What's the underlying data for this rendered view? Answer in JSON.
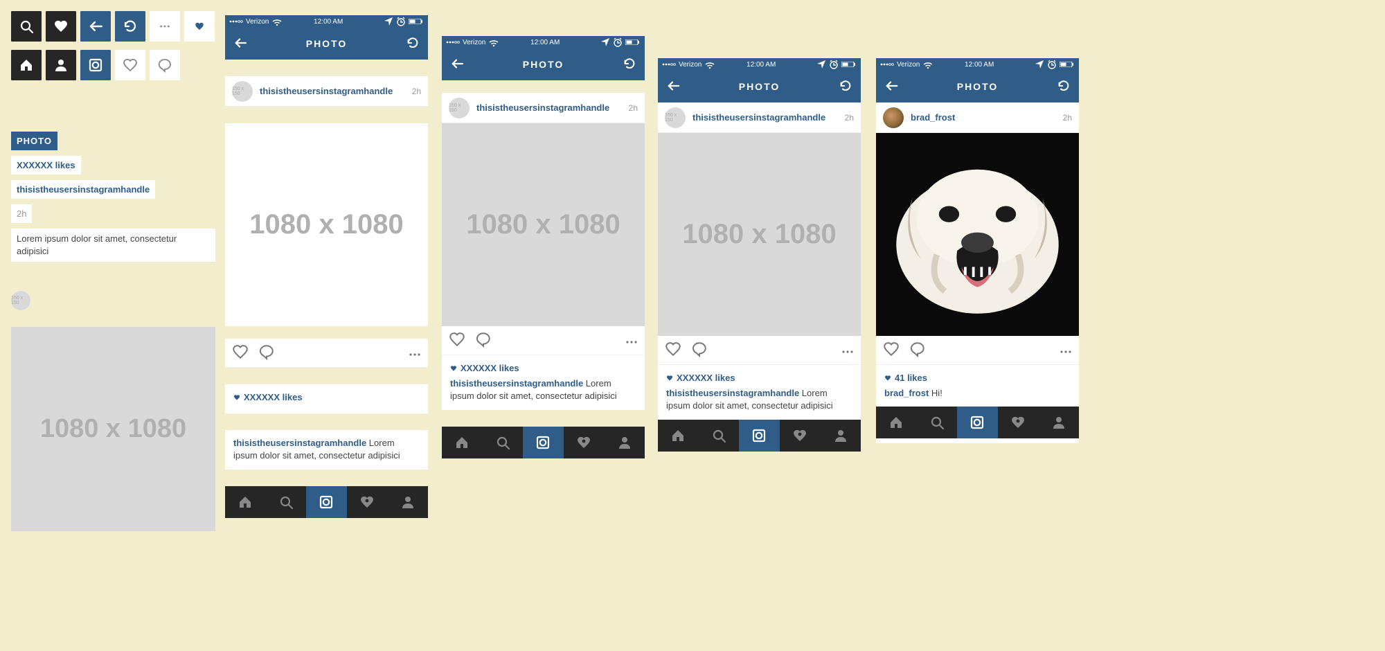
{
  "atoms": {
    "avatar_label": "150 x 150",
    "photo_chip": "PHOTO",
    "likes_chip": "XXXXXX likes",
    "handle_chip": "thisistheusersinstagramhandle",
    "time_chip": "2h",
    "lorem_chip": "Lorem ipsum dolor sit amet, consectetur adipisici",
    "img_label": "1080 x 1080"
  },
  "status": {
    "carrier": "Verizon",
    "time": "12:00 AM"
  },
  "nav_title": "PHOTO",
  "placeholder": {
    "avatar": "150 x 150",
    "image": "1080 x 1080",
    "handle": "thisistheusersinstagramhandle",
    "time_ago": "2h",
    "likes": "XXXXXX likes",
    "caption_body": "Lorem ipsum dolor sit amet, consectetur adipisici"
  },
  "real": {
    "handle": "brad_frost",
    "time_ago": "2h",
    "likes": "41 likes",
    "caption_body": "Hi!"
  }
}
